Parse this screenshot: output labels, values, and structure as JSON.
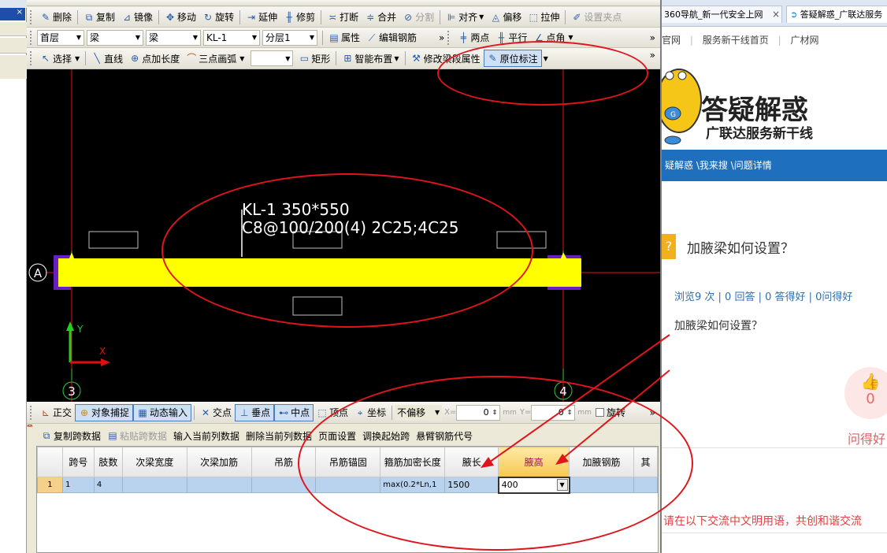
{
  "toolbar1": {
    "delete": "删除",
    "copy": "复制",
    "mirror": "镜像",
    "move": "移动",
    "rotate": "旋转",
    "extend": "延伸",
    "trim": "修剪",
    "break": "打断",
    "merge": "合并",
    "split": "分割",
    "align": "对齐",
    "offset": "偏移",
    "stretch": "拉伸",
    "grip": "设置夹点"
  },
  "toolbar2": {
    "floor": "首层",
    "type1": "梁",
    "type2": "梁",
    "member": "KL-1",
    "layer": "分层1",
    "props": "属性",
    "edit_rebar": "编辑钢筋",
    "more": "»",
    "two_point": "两点",
    "parallel": "平行",
    "point_angle": "点角"
  },
  "toolbar3": {
    "select": "选择",
    "line": "直线",
    "point_length": "点加长度",
    "arc": "三点画弧",
    "rect": "矩形",
    "smart": "智能布置",
    "modify_span": "修改梁段属性",
    "original_mark": "原位标注"
  },
  "canvas": {
    "beam_label_1": "KL-1 350*550",
    "beam_label_2": "C8@100/200(4) 2C25;4C25",
    "axis_a": "A",
    "axis_3": "3",
    "axis_4": "4",
    "y": "Y",
    "x": "X"
  },
  "statusbar": {
    "ortho": "正交",
    "snap": "对象捕捉",
    "dyn": "动态输入",
    "intersect": "交点",
    "perp": "垂点",
    "mid": "中点",
    "vertex": "顶点",
    "coord": "坐标",
    "no_offset": "不偏移",
    "x_label": "X=",
    "x_val": "0",
    "y_label": "Y=",
    "y_val": "0",
    "mm": "mm",
    "rotate": "旋转"
  },
  "gridtb": {
    "copy_span": "复制跨数据",
    "paste_span": "粘贴跨数据",
    "input_col": "输入当前列数据",
    "delete_col": "删除当前列数据",
    "page_setup": "页面设置",
    "swap_start": "调换起始跨",
    "cantilever": "悬臂钢筋代号"
  },
  "grid": {
    "headers": [
      "跨号",
      "肢数",
      "次梁宽度",
      "次梁加筋",
      "吊筋",
      "吊筋锚固",
      "箍筋加密长度",
      "腋长",
      "腋高",
      "加腋钢筋",
      "其"
    ],
    "row": {
      "num": "1",
      "span": "1",
      "legs": "4",
      "dense": "max(0.2*Ln,1",
      "haunch_len": "1500",
      "haunch_h": "400"
    }
  },
  "browser": {
    "tab1": "360导航_新一代安全上网",
    "tab2": "答疑解惑_广联达服务",
    "links": [
      "官网",
      "服务新干线首页",
      "广材网"
    ],
    "logo_title": "答疑解惑",
    "logo_sub": "广联达服务新干线",
    "breadcrumb": "疑解惑 \\我来搜 \\问题详情",
    "question": "加腋梁如何设置？",
    "stats": "浏览9 次 | 0 回答 | 0 答得好 | 0问得好",
    "body": "加腋梁如何设置？",
    "likes": "0",
    "ask_good": "问得好",
    "notice": "请在以下交流中文明用语，共创和谐交流"
  },
  "colors": {
    "beam": "#ffff00",
    "canvas": "#000000",
    "annotation": "#e0151b",
    "accent": "#1e6fbe"
  }
}
